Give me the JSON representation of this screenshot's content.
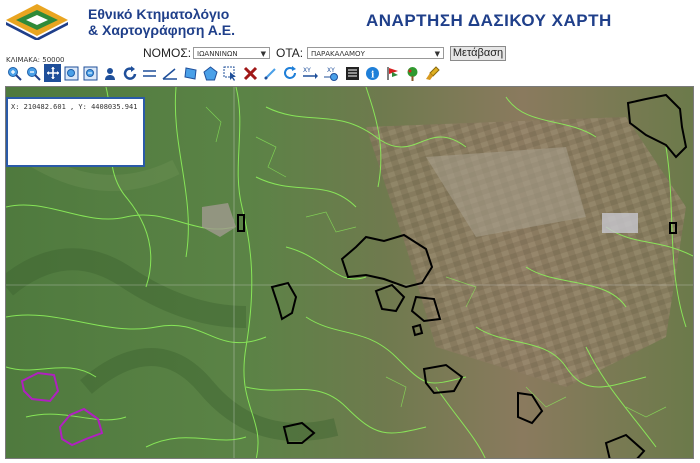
{
  "header": {
    "org_line1": "Εθνικό Κτηματολόγιο",
    "org_line2": "& Χαρτογράφηση Α.Ε.",
    "title": "ΑΝΑΡΤΗΣΗ ΔΑΣΙΚΟΥ ΧΑΡΤΗ",
    "brand_color": "#1f3f8a",
    "logo_colors": [
      "#e9a521",
      "#2f8a3a",
      "#1f3f8a"
    ]
  },
  "scale": {
    "label": "ΚΛΙΜΑΚΑ: 50000"
  },
  "filters": {
    "nomos_label": "ΝΟΜΟΣ:",
    "nomos_value": "ΙΩΑΝΝΙΝΩΝ",
    "ota_label": "ΟΤΑ:",
    "ota_value": "ΠΑΡΑΚΑΛΑΜΟΥ",
    "go_label": "Μετάβαση"
  },
  "toolbar": [
    "zoom-in-icon",
    "zoom-out-icon",
    "pan-icon",
    "zoom-box-icon",
    "zoom-extent-icon",
    "identify-user-icon",
    "back-icon",
    "measure-line-icon",
    "measure-angle-icon",
    "polygon-icon",
    "pentagon-icon",
    "select-arrow-icon",
    "clear-x-icon",
    "draw-line-icon",
    "refresh-icon",
    "goto-xy-icon",
    "export-xy-icon",
    "legend-icon",
    "info-icon",
    "flag-icon",
    "tree-icon",
    "forest-tree-icon",
    "eraser-brush-icon"
  ],
  "coordinates": {
    "text": "X: 210482.601 , Y: 4408035.941"
  },
  "map": {
    "forest_boundary_color": "#8cf05a",
    "highlight_color": "#000000",
    "selection_color": "#b020c0"
  }
}
